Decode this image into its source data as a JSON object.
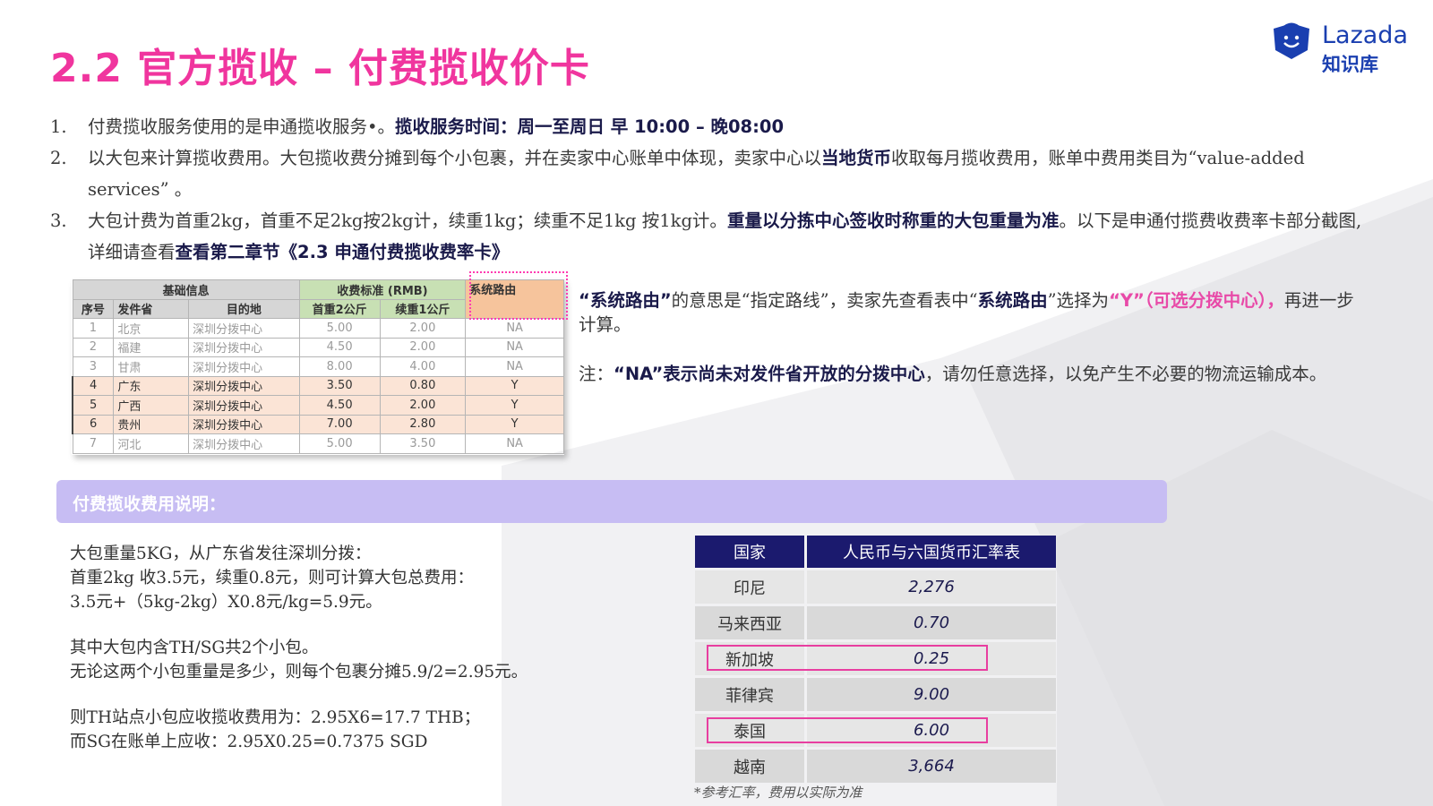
{
  "title": "2.2 官方揽收 – 付费揽收价卡",
  "logo": {
    "brand": "Lazada",
    "sub": "知识库"
  },
  "intro": [
    {
      "num": "1.",
      "segments": [
        "付费揽收服务使用的是申通揽收服务•。",
        "揽收服务时间：周一至周日 早 10:00 – 晚08:00"
      ]
    },
    {
      "num": "2.",
      "segments": [
        "以大包来计算揽收费用。大包揽收费分摊到每个小包裹，并在卖家中心账单中体现，卖家中心以",
        "当地货币",
        "收取每月揽收费用，账单中费用类目为“value-added services” 。"
      ]
    },
    {
      "num": "3.",
      "segments": [
        "大包计费为首重2kg，首重不足2kg按2kg计，续重1kg；续重不足1kg 按1kg计。",
        "重量以分拣中心签收时称重的大包重量为准",
        "。以下是申通付揽费收费率卡部分截图,详细请查看",
        "查看第二章节《2.3 申通付费揽收费率卡》"
      ]
    }
  ],
  "rate_table": {
    "group_headers": {
      "basic": "基础信息",
      "fee": "收费标准 (RMB)",
      "route": "系统路由"
    },
    "columns": [
      "序号",
      "发件省",
      "目的地",
      "首重2公斤",
      "续重1公斤"
    ],
    "rows": [
      [
        "1",
        "北京",
        "深圳分拨中心",
        "5.00",
        "2.00",
        "NA"
      ],
      [
        "2",
        "福建",
        "深圳分拨中心",
        "4.50",
        "2.00",
        "NA"
      ],
      [
        "3",
        "甘肃",
        "深圳分拨中心",
        "8.00",
        "4.00",
        "NA"
      ],
      [
        "4",
        "广东",
        "深圳分拨中心",
        "3.50",
        "0.80",
        "Y"
      ],
      [
        "5",
        "广西",
        "深圳分拨中心",
        "4.50",
        "2.00",
        "Y"
      ],
      [
        "6",
        "贵州",
        "深圳分拨中心",
        "7.00",
        "2.80",
        "Y"
      ],
      [
        "7",
        "河北",
        "深圳分拨中心",
        "5.00",
        "3.50",
        "NA"
      ]
    ]
  },
  "note1": {
    "a": "“系统路由”",
    "b": "的意思是“指定路线”，卖家先查看表中“",
    "c": "系统路由",
    "d": "”选择为",
    "e": "“Y”（可选分拨中心），",
    "f": "再进一步计算。"
  },
  "note2": {
    "a": "注：",
    "b": "“NA”表示尚未对发件省开放的分拨中心",
    "c": "，请勿任意选择，以免产生不必要的物流运输成本。"
  },
  "banner": "付费揽收费用说明：",
  "example": [
    "大包重量5KG，从广东省发往深圳分拨：",
    "首重2kg 收3.5元，续重0.8元，则可计算大包总费用：",
    "3.5元+（5kg-2kg）X0.8元/kg=5.9元。",
    "",
    "其中大包内含TH/SG共2个小包。",
    "无论这两个小包重量是多少，则每个包裹分摊5.9/2=2.95元。",
    "",
    "则TH站点小包应收揽收费用为：2.95X6=17.7 THB；",
    "而SG在账单上应收：2.95X0.25=0.7375 SGD"
  ],
  "currency_table": {
    "headers": [
      "国家",
      "人民币与六国货币汇率表"
    ],
    "rows": [
      [
        "印尼",
        "2,276"
      ],
      [
        "马来西亚",
        "0.70"
      ],
      [
        "新加坡",
        "0.25"
      ],
      [
        "菲律宾",
        "9.00"
      ],
      [
        "泰国",
        "6.00"
      ],
      [
        "越南",
        "3,664"
      ]
    ]
  },
  "footnote": "*参考汇率，费用以实际为准",
  "colors": {
    "title": "#f0359e",
    "brand": "#1a3fb0",
    "header_dark": "#1b1a6e",
    "banner": "#c7bdf3",
    "highlight_box": "#e83ea0"
  }
}
